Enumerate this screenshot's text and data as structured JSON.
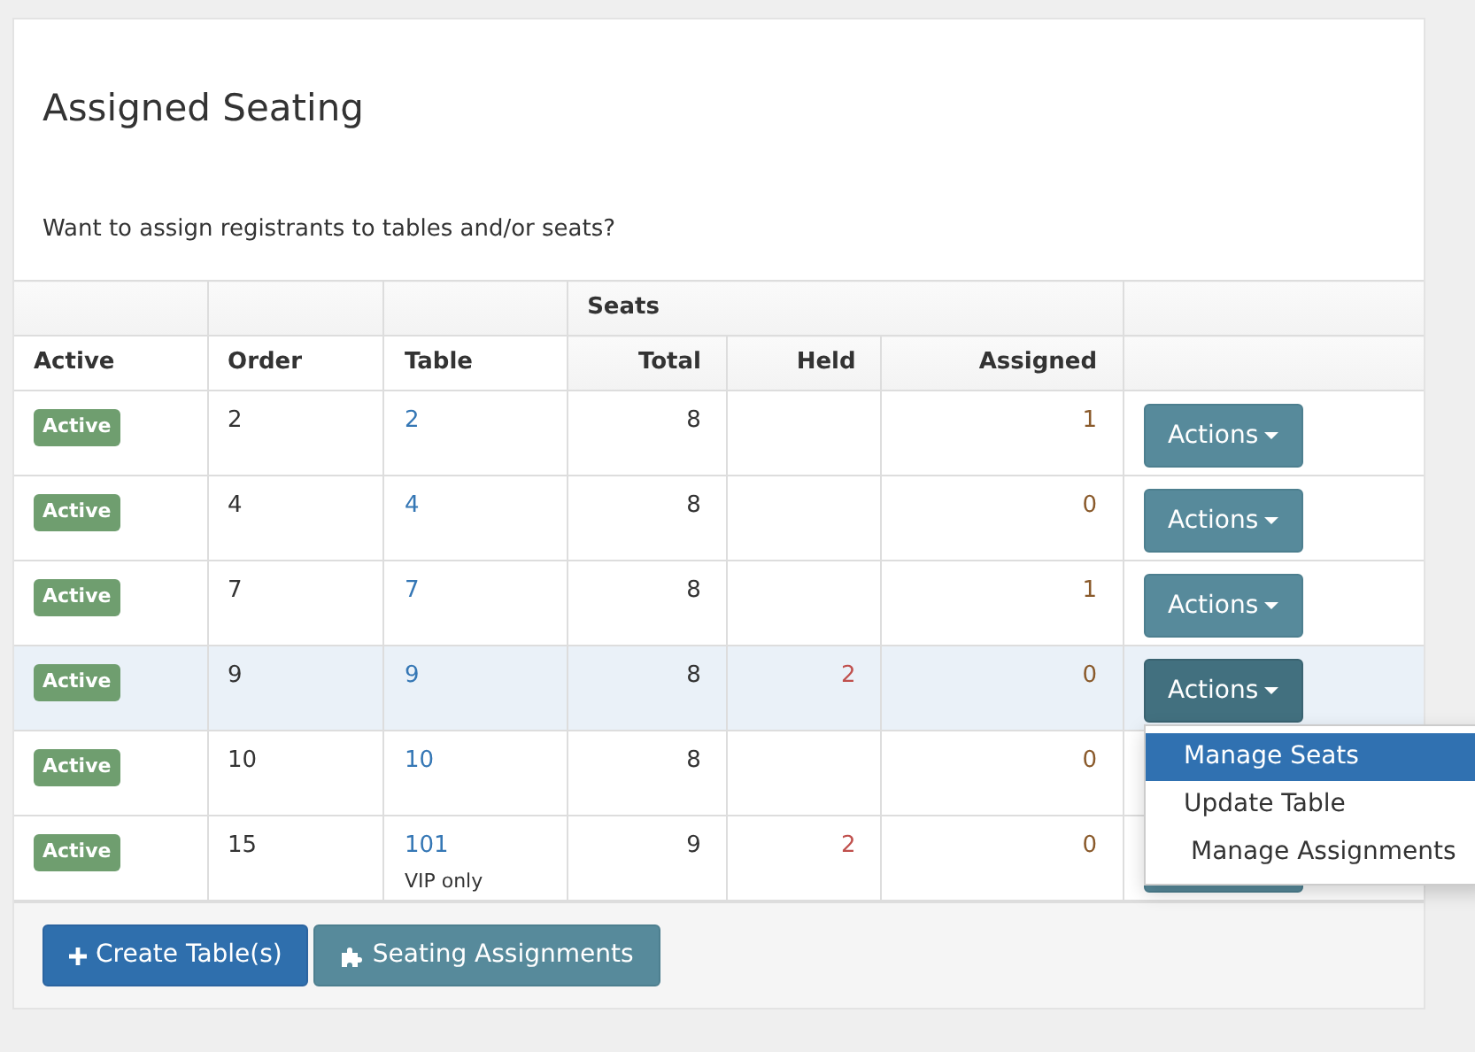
{
  "panel": {
    "title": "Assigned Seating",
    "description": "Want to assign registrants to tables and/or seats?"
  },
  "table": {
    "group_header": "Seats",
    "columns": [
      "Active",
      "Order",
      "Table",
      "Total",
      "Held",
      "Assigned"
    ],
    "rows": [
      {
        "status": "Active",
        "order": "2",
        "table": "2",
        "total": "8",
        "assigned": "1",
        "action": "Actions",
        "selected": false,
        "expanded": false
      },
      {
        "status": "Active",
        "order": "4",
        "table": "4",
        "total": "8",
        "assigned": "0",
        "action": "Actions",
        "selected": false,
        "expanded": false
      },
      {
        "status": "Active",
        "order": "7",
        "table": "7",
        "total": "8",
        "assigned": "1",
        "action": "Actions",
        "selected": false,
        "expanded": false
      },
      {
        "status": "Active",
        "order": "9",
        "table": "9",
        "total": "8",
        "held": "2",
        "assigned": "0",
        "action": "Actions",
        "selected": true,
        "expanded": true
      },
      {
        "status": "Active",
        "order": "10",
        "table": "10",
        "total": "8",
        "assigned": "0",
        "selected": false
      },
      {
        "status": "Active",
        "order": "15",
        "table": "101",
        "note": "VIP only",
        "total": "9",
        "held": "2",
        "assigned": "0",
        "selected": false
      }
    ],
    "dropdown_menu": [
      {
        "label": "Manage Seats",
        "kind": "plain",
        "selected": true
      },
      {
        "label": "Update Table",
        "kind": "plain",
        "selected": false
      },
      {
        "label": "Manage Assignments",
        "kind": "puzzle",
        "selected": false
      }
    ]
  },
  "buttons": [
    {
      "label": "Create Table(s)",
      "kind": "create"
    },
    {
      "label": "Seating Assignments",
      "kind": "assign"
    }
  ]
}
